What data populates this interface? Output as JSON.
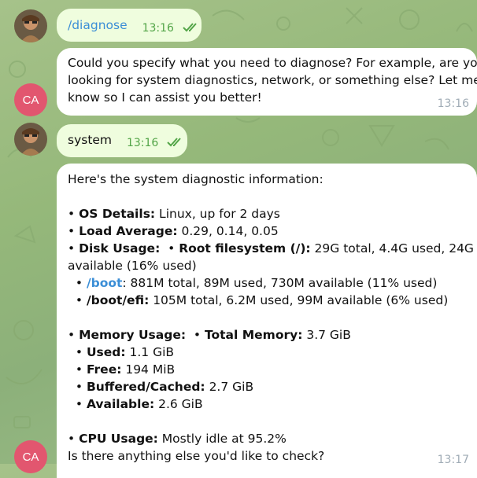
{
  "colors": {
    "outgoing_bubble": "#effdde",
    "incoming_bubble": "#ffffff",
    "check_color": "#53a548",
    "avatar_ca": "#e2566f",
    "link": "#3b8ed6"
  },
  "bot_avatar": {
    "initials": "CA"
  },
  "messages": [
    {
      "id": "m1",
      "direction": "out",
      "text": "/diagnose",
      "time": "13:16",
      "status": "read"
    },
    {
      "id": "m2",
      "direction": "in",
      "lines": [
        "Could you specify what you need to diagnose? For example, are you",
        "looking for system diagnostics, network, or something else? Let me",
        "know so I can assist you better!"
      ],
      "time": "13:16"
    },
    {
      "id": "m3",
      "direction": "out",
      "text": "system",
      "time": "13:16",
      "status": "read"
    },
    {
      "id": "m4",
      "direction": "in",
      "intro": "Here's the system diagnostic information:",
      "os": {
        "label": "OS Details:",
        "value": " Linux, up for 2 days"
      },
      "load": {
        "label": "Load Average:",
        "value": " 0.29, 0.14, 0.05"
      },
      "disk": {
        "label": "Disk Usage:",
        "root_label": "Root filesystem (/):",
        "root_value": " 29G total, 4.4G used, 24G",
        "root_cont": "available (16% used)",
        "boot_label": "/boot",
        "boot_value": ": 881M total, 89M used, 730M available (11% used)",
        "efi_label": "/boot/efi:",
        "efi_value": " 105M total, 6.2M used, 99M available (6% used)"
      },
      "memory": {
        "label": "Memory Usage:",
        "total_label": "Total Memory:",
        "total_value": " 3.7 GiB",
        "used_label": "Used:",
        "used_value": " 1.1 GiB",
        "free_label": "Free:",
        "free_value": " 194 MiB",
        "buffered_label": "Buffered/Cached:",
        "buffered_value": " 2.7 GiB",
        "available_label": "Available:",
        "available_value": " 2.6 GiB"
      },
      "cpu": {
        "label": "CPU Usage:",
        "value": " Mostly idle at 95.2%"
      },
      "outro": "Is there anything else you'd like to check?",
      "time": "13:17"
    }
  ]
}
